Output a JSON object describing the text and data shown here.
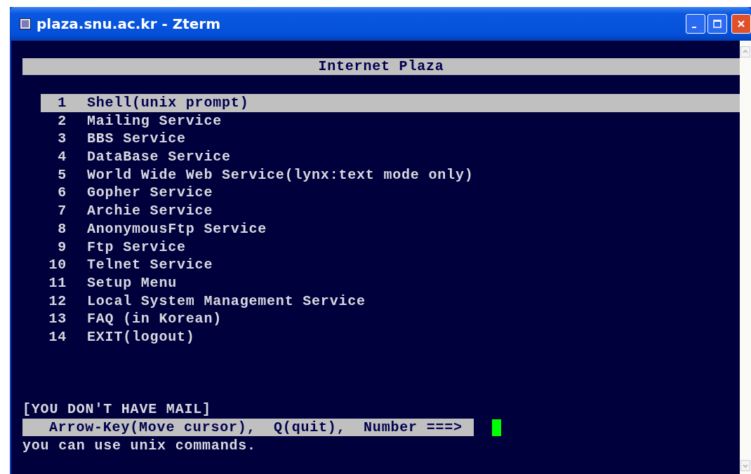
{
  "window": {
    "title": "plaza.snu.ac.kr - Zterm"
  },
  "header": "Internet Plaza",
  "menu": [
    {
      "number": "1",
      "label": "Shell(unix prompt)",
      "selected": true
    },
    {
      "number": "2",
      "label": "Mailing Service",
      "selected": false
    },
    {
      "number": "3",
      "label": "BBS Service",
      "selected": false
    },
    {
      "number": "4",
      "label": "DataBase Service",
      "selected": false
    },
    {
      "number": "5",
      "label": "World Wide Web Service(lynx:text mode only)",
      "selected": false
    },
    {
      "number": "6",
      "label": "Gopher Service",
      "selected": false
    },
    {
      "number": "7",
      "label": "Archie Service",
      "selected": false
    },
    {
      "number": "8",
      "label": "AnonymousFtp Service",
      "selected": false
    },
    {
      "number": "9",
      "label": "Ftp Service",
      "selected": false
    },
    {
      "number": "10",
      "label": "Telnet Service",
      "selected": false
    },
    {
      "number": "11",
      "label": "Setup Menu",
      "selected": false
    },
    {
      "number": "12",
      "label": "Local System Management Service",
      "selected": false
    },
    {
      "number": "13",
      "label": "FAQ (in Korean)",
      "selected": false
    },
    {
      "number": "14",
      "label": "EXIT(logout)",
      "selected": false
    }
  ],
  "mail_notice": "[YOU DON'T HAVE MAIL]",
  "prompt": "Arrow-Key(Move cursor),  Q(quit),  Number ===>",
  "status_line": "you can use unix commands."
}
